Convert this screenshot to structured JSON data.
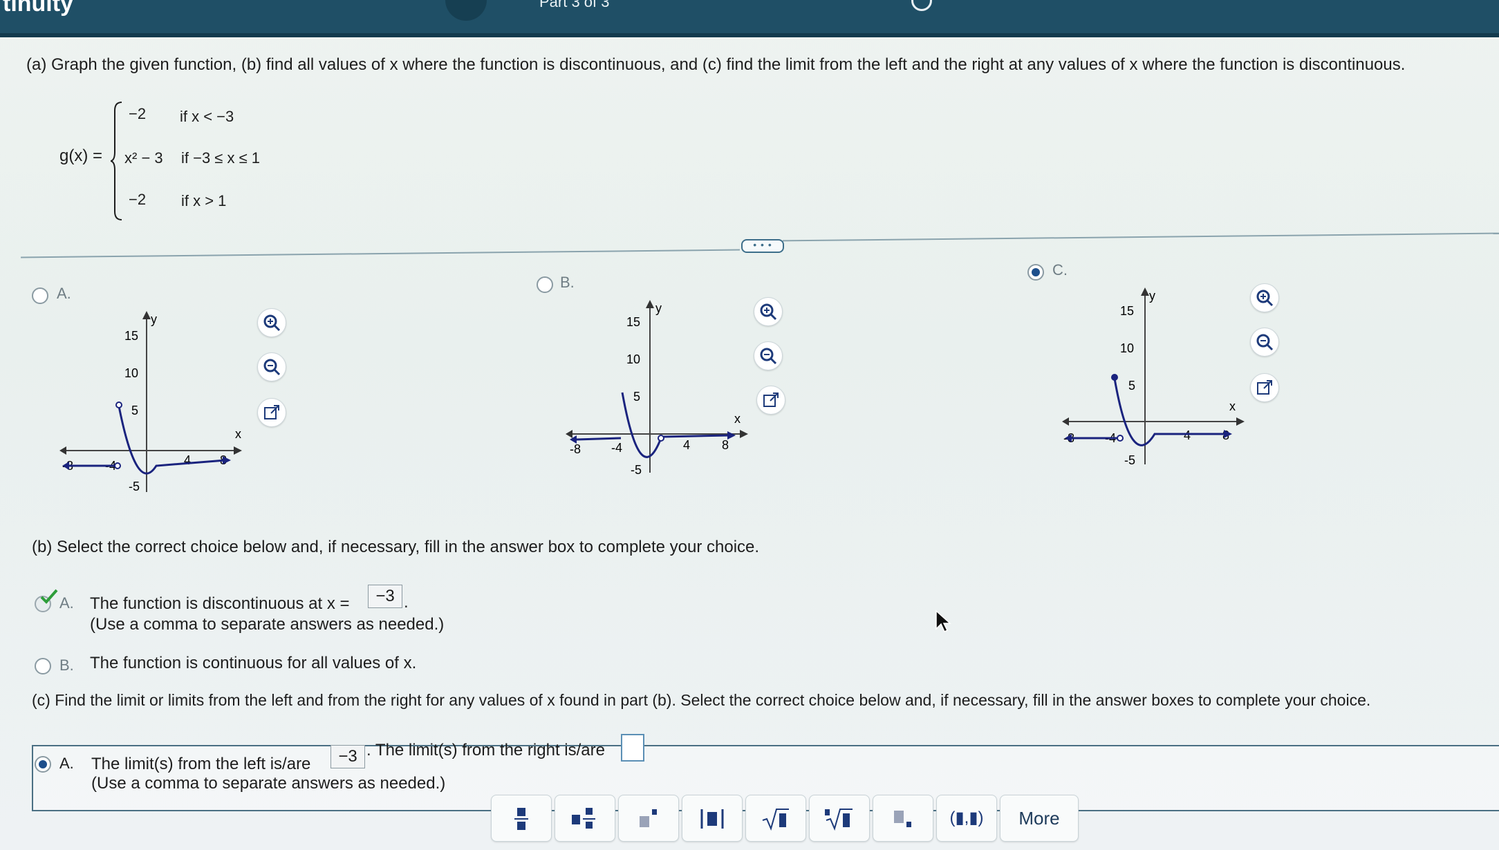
{
  "header": {
    "app_title": "tinuity",
    "part_label": "Part 3 of 3"
  },
  "question": {
    "part_a": "(a) Graph the given function, (b) find all values of x where the function is discontinuous, and (c) find the limit from the left and the right at any values of x where the function is discontinuous.",
    "func_name": "g(x) =",
    "cases": [
      {
        "expr": "−2",
        "cond": "if x < −3"
      },
      {
        "expr": "x² − 3",
        "cond": "if −3 ≤ x ≤ 1"
      },
      {
        "expr": "−2",
        "cond": "if x > 1"
      }
    ],
    "expand_label": "• • •"
  },
  "graph_choices": [
    {
      "letter": "A.",
      "selected": false,
      "y_ticks": [
        "15",
        "10",
        "5",
        "-5"
      ],
      "x_ticks": [
        "-8",
        "-4",
        "4",
        "8"
      ],
      "x_label": "x",
      "y_label": "y"
    },
    {
      "letter": "B.",
      "selected": false,
      "y_ticks": [
        "15",
        "10",
        "5",
        "-5"
      ],
      "x_ticks": [
        "-8",
        "-4",
        "4",
        "8"
      ],
      "x_label": "x",
      "y_label": "y"
    },
    {
      "letter": "C.",
      "selected": true,
      "y_ticks": [
        "15",
        "10",
        "5",
        "-5"
      ],
      "x_ticks": [
        "-8",
        "-4",
        "4",
        "8"
      ],
      "x_label": "x",
      "y_label": "y"
    }
  ],
  "graph_tools": [
    "zoom-in",
    "zoom-out",
    "open-new-window"
  ],
  "part_b": {
    "prompt": "(b) Select the correct choice below and, if necessary, fill in the answer box to complete your choice.",
    "choice_a_letter": "A.",
    "choice_a_text": "The function is discontinuous at x =",
    "choice_a_value": "−3",
    "choice_a_suffix": ".",
    "choice_a_hint": "(Use a comma to separate answers as needed.)",
    "choice_b_letter": "B.",
    "choice_b_text": "The function is continuous for all values of x."
  },
  "part_c": {
    "prompt": "(c) Find the limit or limits from the left and from the right for any values of x found in part (b). Select the correct choice below and, if necessary, fill in the answer boxes to complete your choice.",
    "choice_a_letter": "A.",
    "left_text": "The limit(s) from the left is/are",
    "left_value": "−3",
    "right_text": ". The limit(s) from the right is/are",
    "right_value": "",
    "hint": "(Use a comma to separate answers as needed.)"
  },
  "math_toolbar": {
    "buttons": [
      "fraction",
      "mixed-number",
      "exponent",
      "absolute-value",
      "square-root",
      "nth-root",
      "subscript",
      "interval"
    ],
    "interval_label": "(▮,▮)",
    "more_label": "More"
  },
  "colors": {
    "header": "#1f4f66",
    "curve": "#1a237e",
    "accent": "#1d4f8c"
  }
}
